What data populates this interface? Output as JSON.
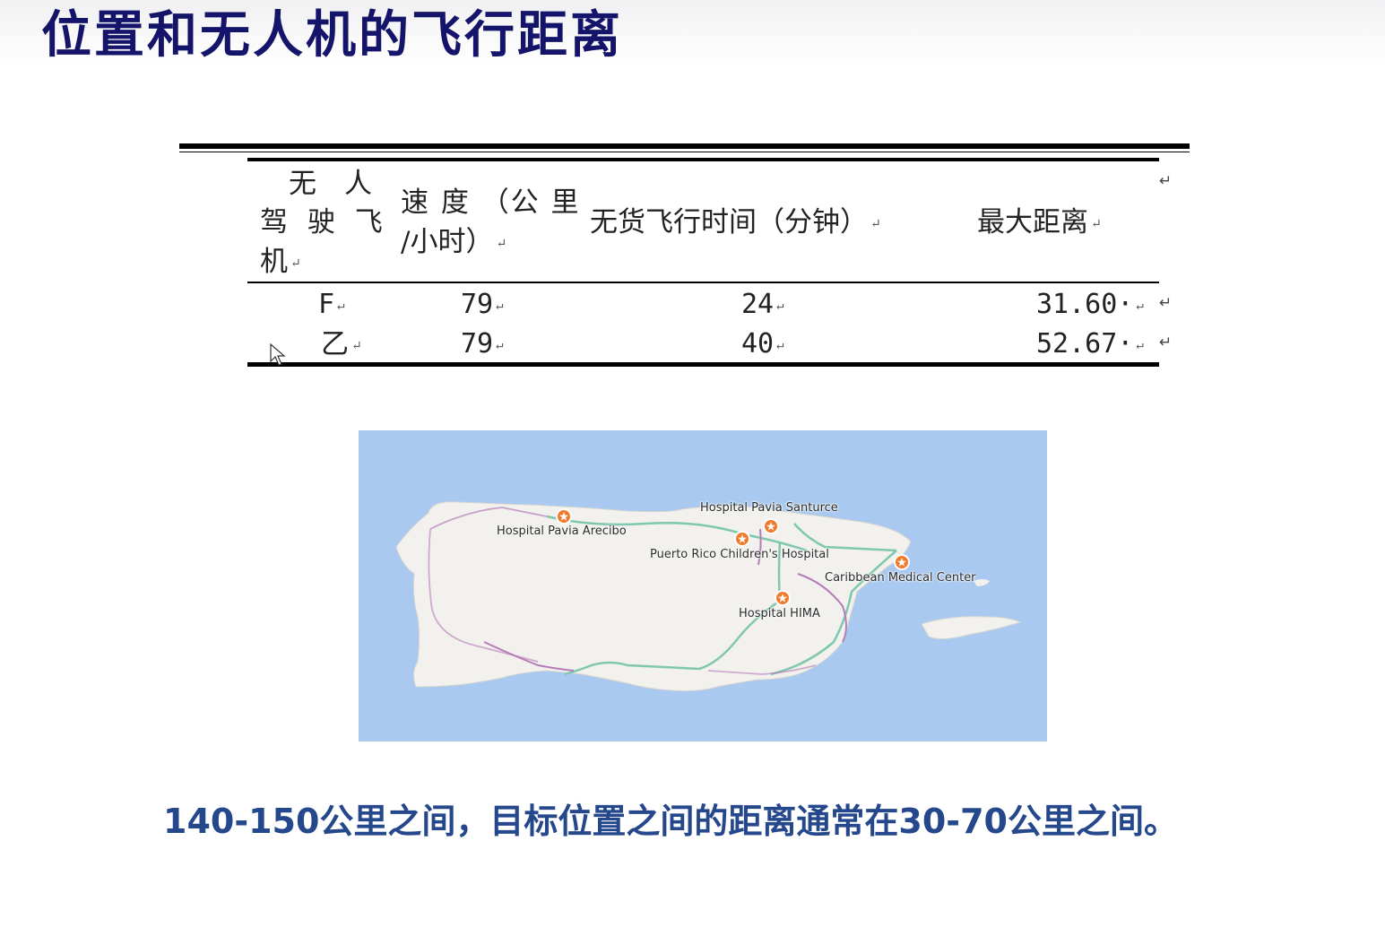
{
  "slide": {
    "title": "位置和无人机的飞行距离",
    "caption": "140-150公里之间，目标位置之间的距离通常在30-70公里之间。"
  },
  "table": {
    "headers": {
      "drone_line1": "无　人",
      "drone_line2": "驾 驶 飞",
      "drone_line3": "机",
      "speed_line1": "速 度 （公 里",
      "speed_line2": "/小时）",
      "flight_time": "无货飞行时间（分钟）",
      "max_distance": "最大距离"
    },
    "rows": [
      {
        "drone": "F",
        "speed": "79",
        "flight_time": "24",
        "max_distance": "31.60·"
      },
      {
        "drone": "乙",
        "speed": "79",
        "flight_time": "40",
        "max_distance": "52.67·"
      }
    ]
  },
  "map": {
    "hospitals": [
      {
        "name": "Hospital Pavia Arecibo"
      },
      {
        "name": "Hospital Pavia Santurce"
      },
      {
        "name": "Puerto Rico Children's Hospital"
      },
      {
        "name": "Caribbean Medical Center"
      },
      {
        "name": "Hospital HIMA"
      }
    ],
    "colors": {
      "ocean": "#a9c9f0",
      "land": "#f2f1ed",
      "primary_road": "#7fc7b0",
      "secondary_road": "#b67cb8",
      "marker": "#f07a2a"
    }
  }
}
